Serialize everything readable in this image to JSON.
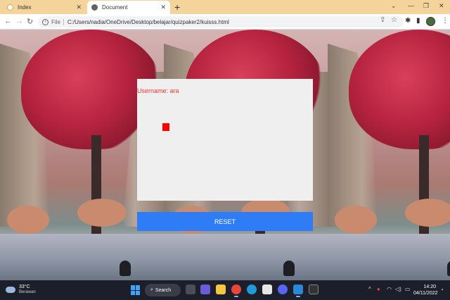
{
  "browser": {
    "tabs": [
      {
        "title": "Index",
        "active": false
      },
      {
        "title": "Document",
        "active": true
      }
    ],
    "new_tab_icon": "+",
    "url_scheme": "File",
    "url": "C:/Users/nadia/OneDrive/Desktop/belajar/quizpaker2/kuisss.html"
  },
  "quiz": {
    "username_text": "Username: ara",
    "reset_label": "RESET",
    "target_color": "#ff0000",
    "button_color": "#2f7df6"
  },
  "taskbar": {
    "weather_temp": "33°C",
    "weather_condition": "Berawan",
    "search_label": "Search",
    "time": "14:20",
    "date": "04/11/2022"
  }
}
